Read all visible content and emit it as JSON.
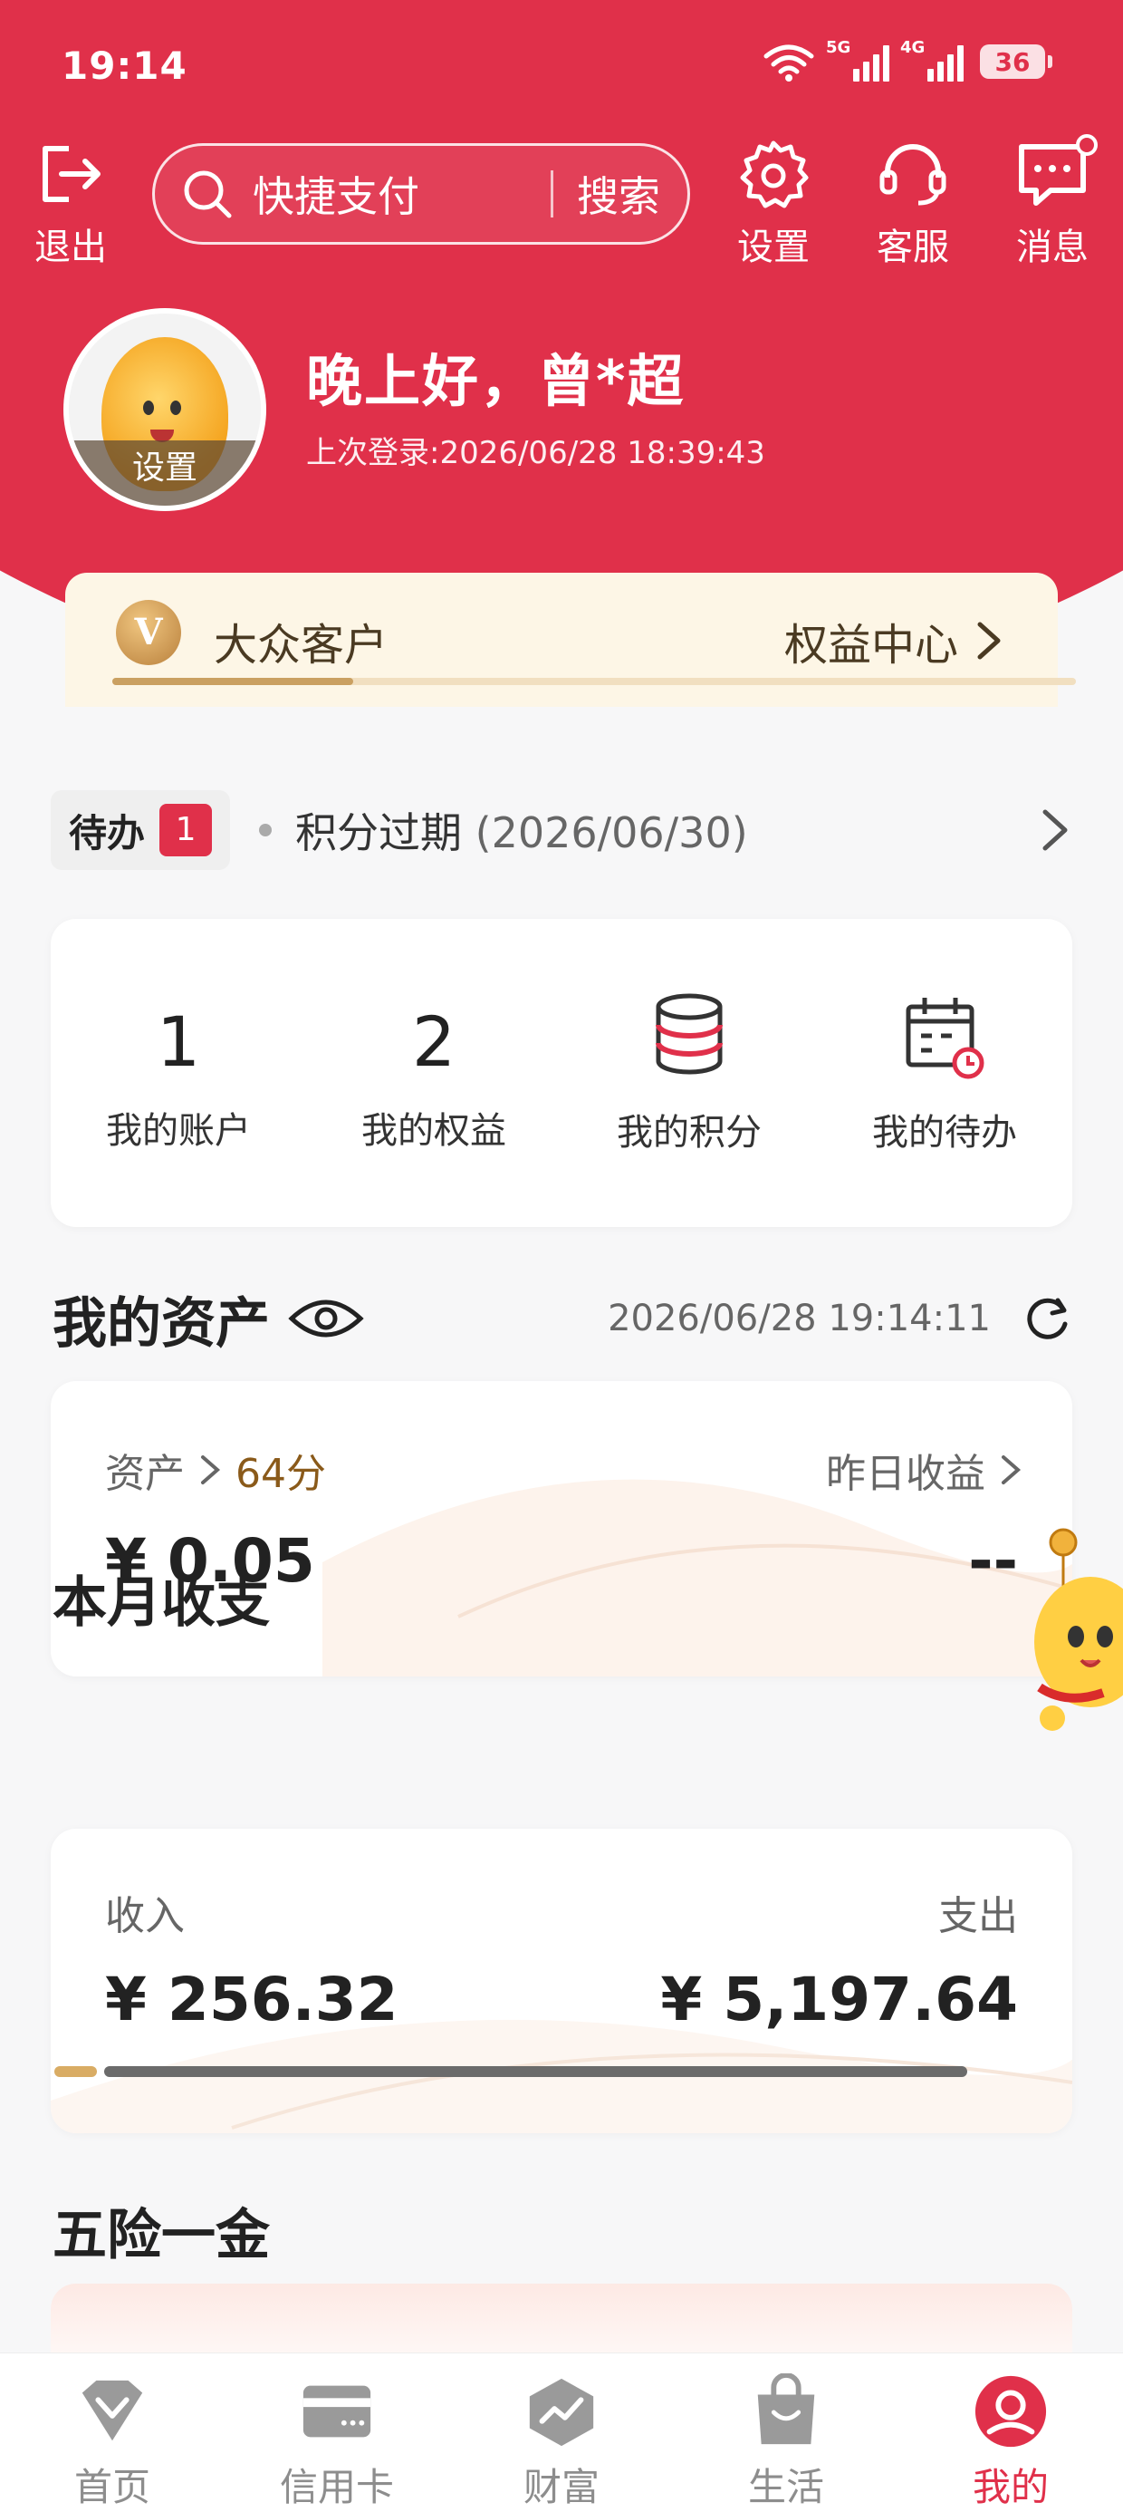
{
  "status_bar": {
    "time": "19:14",
    "net1": "5G",
    "net2": "4G",
    "battery": "36"
  },
  "header": {
    "logout_label": "退出",
    "search_placeholder": "快捷支付",
    "search_button": "搜索",
    "settings_label": "设置",
    "service_label": "客服",
    "messages_label": "消息"
  },
  "profile": {
    "avatar_label": "设置",
    "greeting": "晚上好，曾*超",
    "last_login": "上次登录:2026/06/28 18:39:43"
  },
  "vip": {
    "badge": "V",
    "level": "大众客户",
    "link": "权益中心",
    "progress": 0.25
  },
  "todo": {
    "tag": "待办",
    "count": "1",
    "message": "积分过期",
    "date": "(2026/06/30)"
  },
  "stats": [
    {
      "value": "1",
      "label": "我的账户"
    },
    {
      "value": "2",
      "label": "我的权益"
    },
    {
      "icon": "coin-stack-icon",
      "label": "我的积分"
    },
    {
      "icon": "calendar-clock-icon",
      "label": "我的待办"
    }
  ],
  "assets": {
    "title": "我的资产",
    "timestamp": "2026/06/28 19:14:11",
    "asset_label": "资产",
    "asset_cents": "64分",
    "asset_value": "¥ 0.05",
    "yesterday_label": "昨日收益",
    "yesterday_value": "--"
  },
  "monthly": {
    "title": "本月收支",
    "income_label": "收入",
    "expense_label": "支出",
    "income_value": "¥ 256.32",
    "expense_value": "¥ 5,197.64",
    "income_share": 0.047
  },
  "insurance": {
    "title": "五险一金"
  },
  "nav": [
    {
      "label": "首页",
      "icon": "home-diamond-icon"
    },
    {
      "label": "信用卡",
      "icon": "credit-card-icon"
    },
    {
      "label": "财富",
      "icon": "wealth-icon"
    },
    {
      "label": "生活",
      "icon": "shopping-bag-icon"
    },
    {
      "label": "我的",
      "icon": "user-icon",
      "active": true
    }
  ],
  "colors": {
    "primary": "#e0304a",
    "gold": "#caa061",
    "vip_bg": "#fdf6e6"
  }
}
